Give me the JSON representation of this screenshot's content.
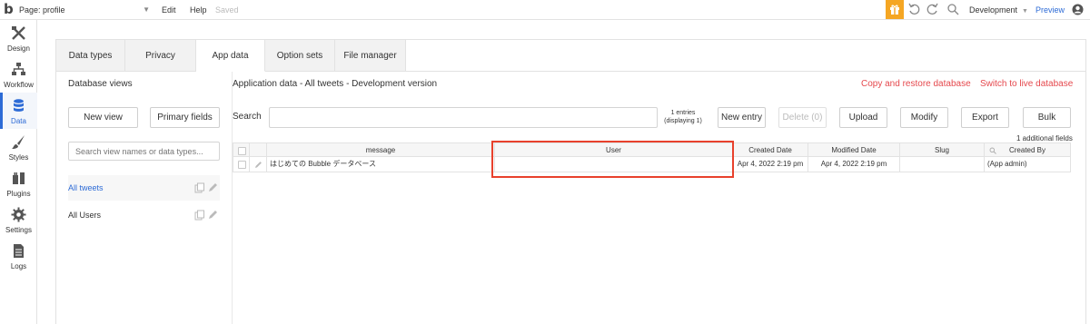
{
  "topbar": {
    "logo": "b",
    "page_label": "Page: profile",
    "edit": "Edit",
    "help": "Help",
    "saved": "Saved",
    "environment": "Development",
    "preview": "Preview",
    "accent_color": "#f5a623"
  },
  "leftnav": {
    "items": [
      {
        "label": "Design",
        "icon": "design-icon"
      },
      {
        "label": "Workflow",
        "icon": "workflow-icon"
      },
      {
        "label": "Data",
        "icon": "data-icon",
        "active": true
      },
      {
        "label": "Styles",
        "icon": "styles-icon"
      },
      {
        "label": "Plugins",
        "icon": "plugins-icon"
      },
      {
        "label": "Settings",
        "icon": "settings-icon"
      },
      {
        "label": "Logs",
        "icon": "logs-icon"
      }
    ],
    "active_color": "#2d6bd6"
  },
  "tabs": [
    "Data types",
    "Privacy",
    "App data",
    "Option sets",
    "File manager"
  ],
  "active_tab": "App data",
  "left_panel": {
    "title": "Database views",
    "new_view": "New view",
    "primary_fields": "Primary fields",
    "search_placeholder": "Search view names or data types...",
    "views": [
      {
        "label": "All tweets",
        "selected": true
      },
      {
        "label": "All Users",
        "selected": false
      }
    ]
  },
  "right_panel": {
    "title": "Application data - All tweets - Development version",
    "copy_restore": "Copy and restore database",
    "switch_live": "Switch to live database",
    "search_label": "Search",
    "search_value": "",
    "entries_line1": "1 entries",
    "entries_line2": "(displaying 1)",
    "buttons": {
      "new_entry": "New entry",
      "delete": "Delete (0)",
      "upload": "Upload",
      "modify": "Modify",
      "export": "Export",
      "bulk": "Bulk"
    },
    "additional_fields": "1 additional fields",
    "link_color": "#e5484d"
  },
  "table": {
    "columns": [
      "message",
      "User",
      "Created Date",
      "Modified Date",
      "Slug",
      "Created By"
    ],
    "rows": [
      {
        "message": "はじめての Bubble データベース",
        "user": "",
        "created_date": "Apr 4, 2022 2:19 pm",
        "modified_date": "Apr 4, 2022 2:19 pm",
        "slug": "",
        "created_by": "(App admin)"
      }
    ],
    "highlight_column": "User",
    "highlight_color": "#e8412c"
  }
}
